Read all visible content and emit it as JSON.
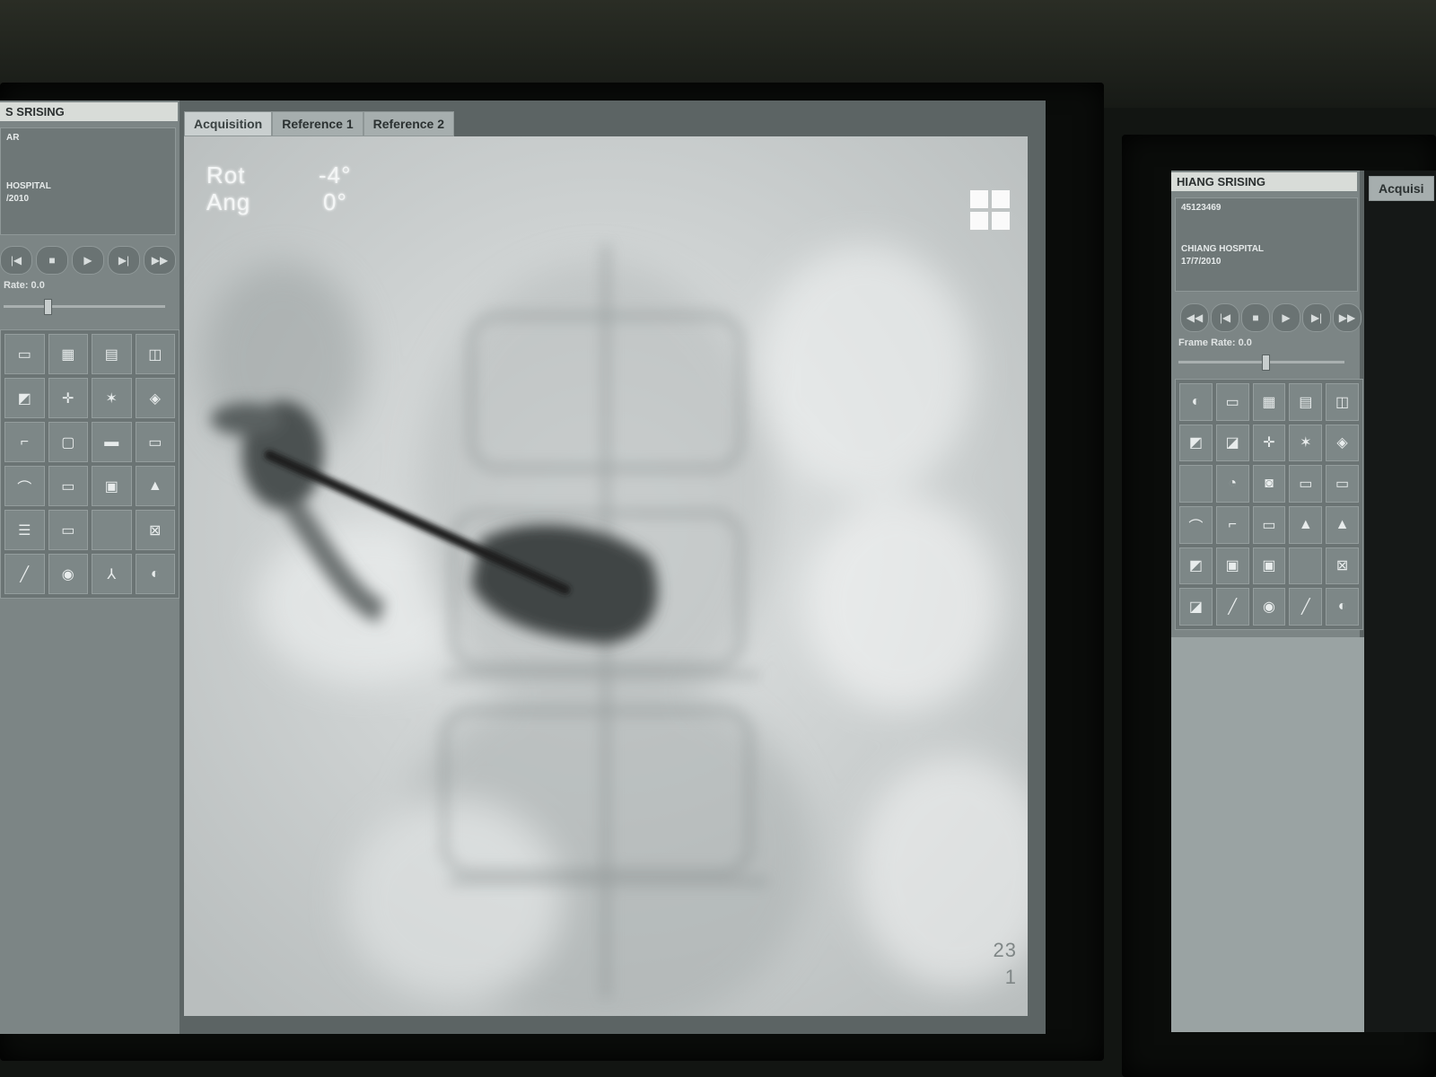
{
  "main_monitor": {
    "patient_name": "S SRISING",
    "info_lines": [
      "AR",
      "",
      "HOSPITAL",
      "/2010"
    ],
    "tabs": [
      {
        "label": "Acquisition",
        "active": true
      },
      {
        "label": "Reference 1",
        "active": false
      },
      {
        "label": "Reference 2",
        "active": false
      }
    ],
    "playback_buttons": [
      "|◀",
      "■",
      "▶",
      "▶|",
      "▶▶"
    ],
    "frame_rate_label": "Rate: 0.0",
    "frame_rate_value": 0.25,
    "tool_icons": [
      "folder-icon",
      "calendar-icon",
      "grid-doc-icon",
      "ruler-icon",
      "measure-icon",
      "crosshair-icon",
      "star-icon",
      "shield-icon",
      "pin-icon",
      "region-icon",
      "chat-icon",
      "film-icon",
      "line-icon",
      "folder-open-icon",
      "stack-icon",
      "print-icon",
      "list-icon",
      "box-icon",
      "blank-icon",
      "cross-box-icon",
      "wrench-icon",
      "eraser-icon",
      "branch-icon",
      "camera-icon"
    ],
    "tool_glyphs": [
      "▭",
      "▦",
      "▤",
      "◫",
      "◩",
      "✛",
      "✶",
      "◈",
      "⌐",
      "▢",
      "▬",
      "▭",
      "⌒",
      "▭",
      "▣",
      "▲",
      "☰",
      "▭",
      "",
      "⊠",
      "╱",
      "◉",
      "⅄",
      "◐"
    ],
    "overlay": {
      "rot_label": "Rot",
      "rot_value": "-4°",
      "ang_label": "Ang",
      "ang_value": "0°",
      "frame_number": "23",
      "frame_sub": "1"
    }
  },
  "second_monitor": {
    "patient_name": "HIANG SRISING",
    "info_lines": [
      "45123469",
      "",
      "CHIANG HOSPITAL",
      "17/7/2010"
    ],
    "tab_label": "Acquisi",
    "playback_buttons": [
      "◀◀",
      "|◀",
      "■",
      "▶",
      "▶|",
      "▶▶"
    ],
    "frame_rate_label": "Frame Rate: 0.0",
    "frame_rate_value": 0.5,
    "tool_glyphs": [
      "◐",
      "▭",
      "▦",
      "▤",
      "◫",
      "◩",
      "◪",
      "✛",
      "✶",
      "◈",
      "",
      "◔",
      "◙",
      "▭",
      "▭",
      "⌒",
      "⌐",
      "▭",
      "▲",
      "▲",
      "◩",
      "▣",
      "▣",
      "",
      "⊠",
      "◪",
      "╱",
      "◉",
      "╱",
      "◐"
    ]
  },
  "colors": {
    "panel": "#7c8585",
    "titlebar": "#d8dcd8",
    "viewer_bg": "#d7dada"
  }
}
